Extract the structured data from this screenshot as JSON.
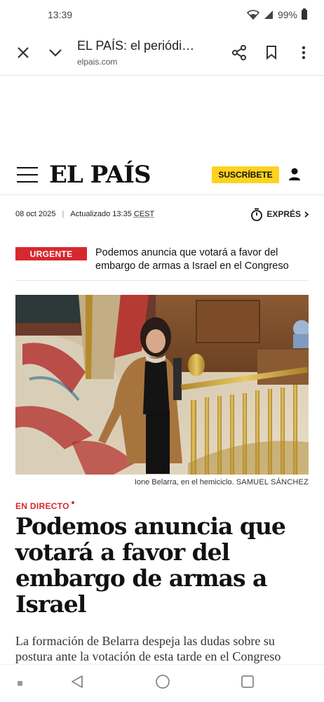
{
  "status_bar": {
    "time": "13:39",
    "battery": "99%"
  },
  "browser": {
    "page_title": "EL PAÍS: el periódico global",
    "domain": "elpais.com"
  },
  "site": {
    "logo": "EL PAÍS",
    "subscribe_label": "SUSCRÍBETE"
  },
  "meta": {
    "date": "08 oct 2025",
    "updated_label": "Actualizado 13:35",
    "timezone": "CEST",
    "expres_label": "EXPRÉS"
  },
  "breaking": {
    "badge": "URGENTE",
    "text": "Podemos anuncia que votará a favor del embargo de armas a Israel en el Congreso"
  },
  "article": {
    "caption": "Ione Belarra, en el hemiciclo.",
    "credit": "Samuel Sánchez",
    "live_label": "EN DIRECTO",
    "headline": "Podemos anuncia que votará a favor del embargo de armas a Israel",
    "lead": "La formación de Belarra despeja las dudas sobre su postura ante la votación de esta tarde en el Congreso"
  },
  "colors": {
    "accent_red": "#d7282f",
    "subscribe_yellow": "#ffd21f"
  }
}
